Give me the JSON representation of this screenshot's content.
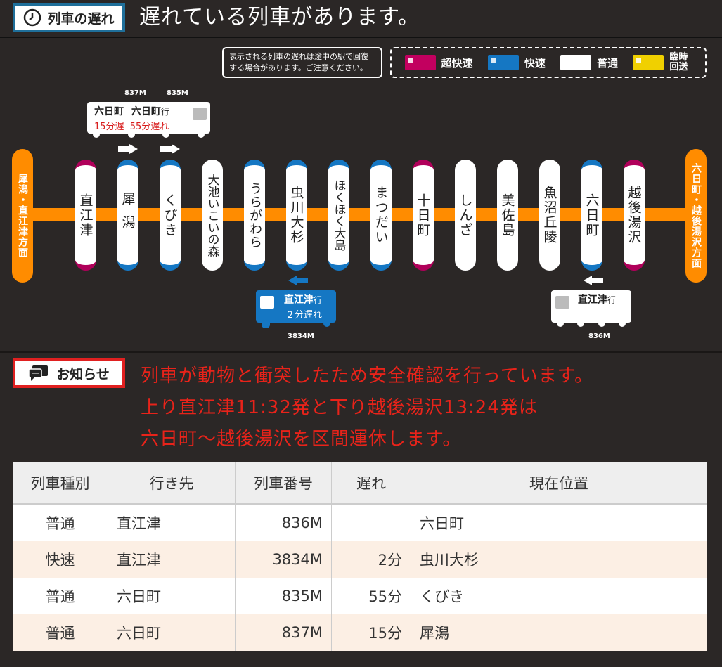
{
  "header": {
    "badge_label": "列車の遅れ",
    "title": "遅れている列車があります。"
  },
  "notice": {
    "text": "表示される列車の遅れは途中の駅で回復する場合があります。ご注意ください。"
  },
  "legend": [
    {
      "label": "超快速",
      "color": "#c2005f"
    },
    {
      "label": "快速",
      "color": "#1577c3"
    },
    {
      "label": "普通",
      "color": "#ffffff"
    },
    {
      "label": "臨時回送",
      "color": "#f0d000"
    }
  ],
  "directions": {
    "left": "犀潟・直江津方面",
    "right": "六日町・越後湯沢方面"
  },
  "stations": [
    {
      "name": "直江津",
      "style": "red"
    },
    {
      "name": "犀潟",
      "style": "blue"
    },
    {
      "name": "くびき",
      "style": "blue"
    },
    {
      "name": "大池いこいの森",
      "style": "plain"
    },
    {
      "name": "うらがわら",
      "style": "blue"
    },
    {
      "name": "虫川大杉",
      "style": "blue"
    },
    {
      "name": "ほくほく大島",
      "style": "blue"
    },
    {
      "name": "まつだい",
      "style": "blue"
    },
    {
      "name": "十日町",
      "style": "red"
    },
    {
      "name": "しんざ",
      "style": "plain"
    },
    {
      "name": "美佐島",
      "style": "plain"
    },
    {
      "name": "魚沼丘陵",
      "style": "plain"
    },
    {
      "name": "六日町",
      "style": "blue"
    },
    {
      "name": "越後湯沢",
      "style": "red"
    }
  ],
  "trains_up": {
    "number_a": "837M",
    "number_b": "835M",
    "dest_a": "六日町",
    "dest_b": "六日町",
    "dest_suffix": "行",
    "delay_a": "15分遅",
    "delay_b": "55分遅れ"
  },
  "train_rapid": {
    "dest": "直江津",
    "suffix": "行",
    "delay": "２分遅れ",
    "number": "3834M"
  },
  "train_local": {
    "dest": "直江津",
    "suffix": "行",
    "number": "836M"
  },
  "info": {
    "badge_label": "お知らせ",
    "lines": [
      "列車が動物と衝突したため安全確認を行っています。",
      "上り直江津11:32発と下り越後湯沢13:24発は",
      "六日町～越後湯沢を区間運休します。"
    ]
  },
  "table": {
    "headers": [
      "列車種別",
      "行き先",
      "列車番号",
      "遅れ",
      "現在位置"
    ],
    "rows": [
      [
        "普通",
        "直江津",
        "836M",
        "",
        "六日町"
      ],
      [
        "快速",
        "直江津",
        "3834M",
        "2分",
        "虫川大杉"
      ],
      [
        "普通",
        "六日町",
        "835M",
        "55分",
        "くびき"
      ],
      [
        "普通",
        "六日町",
        "837M",
        "15分",
        "犀潟"
      ]
    ]
  }
}
